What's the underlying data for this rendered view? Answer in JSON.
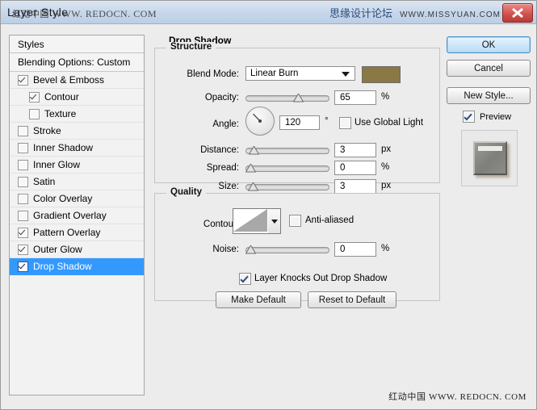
{
  "window": {
    "title": "Layer Style",
    "watermark_left_cn": "红动中国",
    "watermark_left_url": "WWW. REDOCN. COM",
    "watermark_right_cn": "思缘设计论坛",
    "watermark_right_url": "WWW.MISSYUAN.COM",
    "watermark_bottom_cn": "红动中国",
    "watermark_bottom_url": "WWW. REDOCN. COM",
    "close_icon": "close-icon"
  },
  "styles_panel": {
    "header": "Styles",
    "blending_options": "Blending Options: Custom",
    "effects": [
      {
        "label": "Bevel & Emboss",
        "checked": true,
        "indent": false,
        "selected": false
      },
      {
        "label": "Contour",
        "checked": true,
        "indent": true,
        "selected": false
      },
      {
        "label": "Texture",
        "checked": false,
        "indent": true,
        "selected": false
      },
      {
        "label": "Stroke",
        "checked": false,
        "indent": false,
        "selected": false
      },
      {
        "label": "Inner Shadow",
        "checked": false,
        "indent": false,
        "selected": false
      },
      {
        "label": "Inner Glow",
        "checked": false,
        "indent": false,
        "selected": false
      },
      {
        "label": "Satin",
        "checked": false,
        "indent": false,
        "selected": false
      },
      {
        "label": "Color Overlay",
        "checked": false,
        "indent": false,
        "selected": false
      },
      {
        "label": "Gradient Overlay",
        "checked": false,
        "indent": false,
        "selected": false
      },
      {
        "label": "Pattern Overlay",
        "checked": true,
        "indent": false,
        "selected": false
      },
      {
        "label": "Outer Glow",
        "checked": true,
        "indent": false,
        "selected": false
      },
      {
        "label": "Drop Shadow",
        "checked": true,
        "indent": false,
        "selected": true
      }
    ],
    "selection_color": "#3399ff"
  },
  "main": {
    "title": "Drop Shadow",
    "structure": {
      "legend": "Structure",
      "blend_mode_label": "Blend Mode:",
      "blend_mode_value": "Linear Burn",
      "blend_mode_arrow": "chevron-down-icon",
      "shadow_color": "#8a7944",
      "opacity_label": "Opacity:",
      "opacity_value": "65",
      "opacity_unit": "%",
      "opacity_percent": 65,
      "angle_label": "Angle:",
      "angle_value": "120",
      "angle_unit": "°",
      "use_global_light_label": "Use Global Light",
      "use_global_light_checked": false,
      "distance_label": "Distance:",
      "distance_value": "3",
      "distance_unit": "px",
      "distance_percent": 4,
      "spread_label": "Spread:",
      "spread_value": "0",
      "spread_unit": "%",
      "spread_percent": 0,
      "size_label": "Size:",
      "size_value": "3",
      "size_unit": "px",
      "size_percent": 3
    },
    "quality": {
      "legend": "Quality",
      "contour_label": "Contour:",
      "contour_arrow": "chevron-down-icon",
      "anti_aliased_label": "Anti-aliased",
      "anti_aliased_checked": false,
      "noise_label": "Noise:",
      "noise_value": "0",
      "noise_unit": "%",
      "noise_percent": 0
    },
    "knockout_label": "Layer Knocks Out Drop Shadow",
    "knockout_checked": true,
    "make_default_label": "Make Default",
    "reset_default_label": "Reset to Default"
  },
  "right_panel": {
    "ok_label": "OK",
    "cancel_label": "Cancel",
    "new_style_label": "New Style...",
    "preview_label": "Preview",
    "preview_checked": true
  }
}
